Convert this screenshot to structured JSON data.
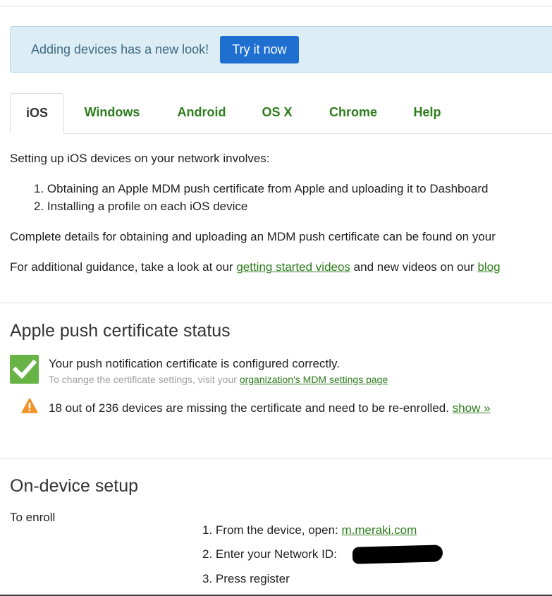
{
  "banner": {
    "text": "Adding devices has a new look!",
    "button_label": "Try it now"
  },
  "tabs": [
    {
      "label": "iOS",
      "active": true
    },
    {
      "label": "Windows",
      "active": false
    },
    {
      "label": "Android",
      "active": false
    },
    {
      "label": "OS X",
      "active": false
    },
    {
      "label": "Chrome",
      "active": false
    },
    {
      "label": "Help",
      "active": false
    }
  ],
  "intro": {
    "lead": "Setting up iOS devices on your network involves:",
    "steps": [
      "1. Obtaining an Apple MDM push certificate from Apple and uploading it to Dashboard",
      "2. Installing a profile on each iOS device"
    ],
    "details_line": "Complete details for obtaining and uploading an MDM push certificate can be found on your",
    "guidance_prefix": "For additional guidance, take a look at our ",
    "guidance_link": "getting started videos",
    "guidance_middle": " and new videos on our ",
    "guidance_link2": "blog"
  },
  "cert_status": {
    "heading": "Apple push certificate status",
    "ok_message": "Your push notification certificate is configured correctly.",
    "sub_prefix": "To change the certificate settings, visit your ",
    "sub_link": "organization's MDM settings page",
    "warning_message": "18 out of 236 devices are missing the certificate and need to be re-enrolled. ",
    "warning_link": "show »"
  },
  "on_device": {
    "heading": "On-device setup",
    "enroll_label": "To enroll",
    "step1_prefix": "1. From the device, open: ",
    "step1_link": "m.meraki.com",
    "step2": "2. Enter your Network ID:",
    "step3": "3. Press register"
  },
  "colors": {
    "link": "#2d7d1c",
    "button": "#1f6fd1",
    "banner_bg": "#dcedf6",
    "success": "#67b346",
    "warning": "#f0942a"
  },
  "icons": [
    "checkmark-icon",
    "warning-icon"
  ]
}
